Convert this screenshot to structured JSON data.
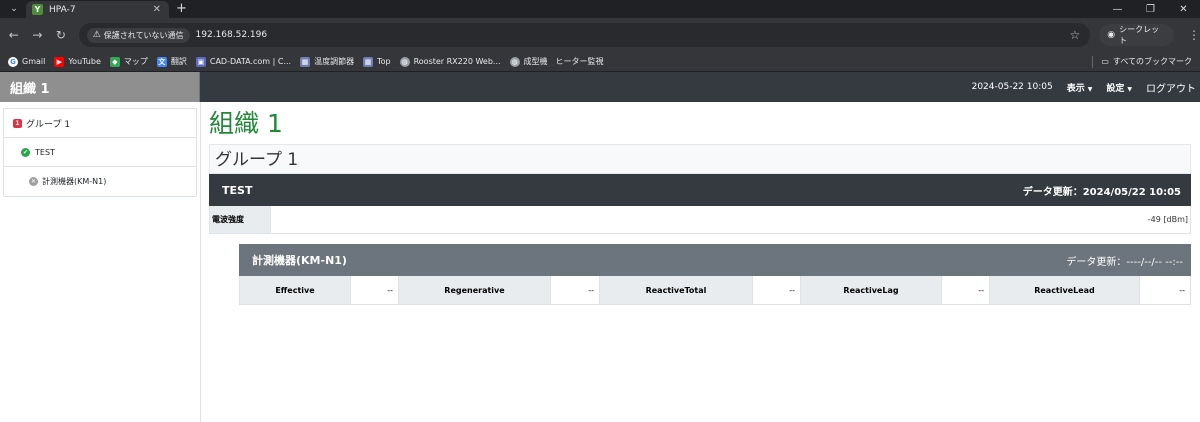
{
  "browser": {
    "tab_title": "HPA-7",
    "security_label": "保護されていない通信",
    "url": "192.168.52.196",
    "incognito_label": "シークレット",
    "bookmarks": [
      "Gmail",
      "YouTube",
      "マップ",
      "翻訳",
      "CAD-DATA.com | C...",
      "温度調節器",
      "Top",
      "Rooster RX220 Web...",
      "成型機　ヒーター監視"
    ],
    "all_bookmarks_label": "すべてのブックマーク"
  },
  "header": {
    "brand": "組織 1",
    "datetime": "2024-05-22 10:05",
    "menu_view": "表示",
    "menu_settings": "設定",
    "logout": "ログアウト"
  },
  "sidebar": {
    "items": [
      {
        "label": "グループ 1",
        "icon_text": "1",
        "icon": "red-badge-icon"
      },
      {
        "label": "TEST",
        "icon_text": "✔",
        "icon": "green-check-icon"
      },
      {
        "label": "計測機器(KM-N1)",
        "icon_text": "✕",
        "icon": "grey-x-icon"
      }
    ]
  },
  "main": {
    "org_title": "組織 1",
    "group_title": "グループ 1",
    "device": {
      "name": "TEST",
      "updated": "データ更新：2024/05/22 10:05",
      "field_label": "電波強度",
      "field_value": "-49 [dBm]"
    },
    "sub_device": {
      "name": "計測機器(KM-N1)",
      "updated": "データ更新：----/--/-- --:--",
      "cells": [
        {
          "label": "Effective",
          "value": "--"
        },
        {
          "label": "Regenerative",
          "value": "--"
        },
        {
          "label": "ReactiveTotal",
          "value": "--"
        },
        {
          "label": "ReactiveLag",
          "value": "--"
        },
        {
          "label": "ReactiveLead",
          "value": "--"
        }
      ]
    }
  },
  "colors": {
    "header_bg": "#343a40",
    "brand_bg": "#8f8f8f",
    "org_title": "#218838",
    "sub_bar_bg": "#6c757d"
  }
}
